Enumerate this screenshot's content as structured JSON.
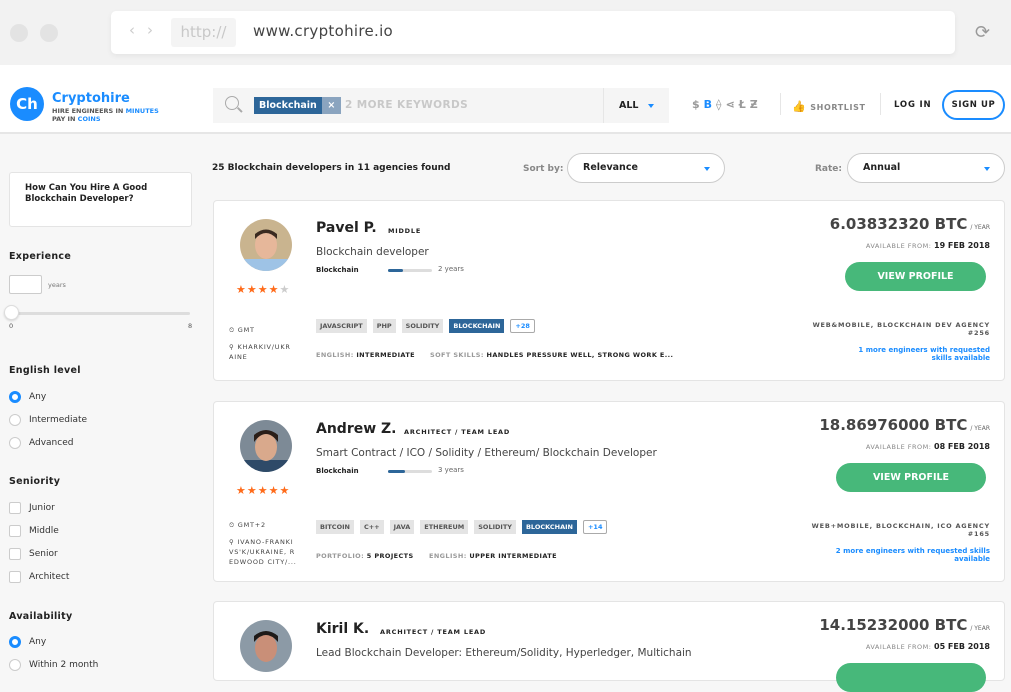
{
  "browser": {
    "protocol": "http://",
    "url": "www.cryptohire.io",
    "back_icon": "‹",
    "forward_icon": "›",
    "reload_icon": "⟳"
  },
  "header": {
    "logo": {
      "mark": "Ch",
      "name": "Cryptohire",
      "tag1a": "HIRE ENGINEERS IN ",
      "tag1b": "MINUTES",
      "tag2a": "PAY IN ",
      "tag2b": "COINS"
    },
    "search": {
      "chip": "Blockchain",
      "chip_remove": "×",
      "placeholder": "2 MORE KEYWORDS",
      "scope": "ALL"
    },
    "currencies": [
      "$",
      "B",
      "⟠",
      "⋖",
      "Ł",
      "Ƶ"
    ],
    "active_currency": "B",
    "shortlist": "SHORTLIST",
    "shortlist_icon": "👍",
    "login": "LOG IN",
    "signup": "SIGN UP"
  },
  "sidebar": {
    "guide": "How Can You Hire A Good Blockchain Developer?",
    "experience": {
      "title": "Experience",
      "value": "",
      "unit": "years",
      "min": "0",
      "max": "8",
      "slider_value": 0
    },
    "english": {
      "title": "English level",
      "options": [
        "Any",
        "Intermediate",
        "Advanced"
      ],
      "selected": "Any"
    },
    "seniority": {
      "title": "Seniority",
      "options": [
        "Junior",
        "Middle",
        "Senior",
        "Architect"
      ]
    },
    "availability": {
      "title": "Availability",
      "options": [
        "Any",
        "Within 2 month"
      ],
      "selected": "Any"
    }
  },
  "results": {
    "summary": "25 Blockchain developers in 11 agencies found",
    "sort_label": "Sort by:",
    "sort_value": "Relevance",
    "rate_label": "Rate:",
    "rate_value": "Annual"
  },
  "cards": [
    {
      "name": "Pavel P.",
      "level": "MIDDLE",
      "title": "Blockchain developer",
      "skill": "Blockchain",
      "skill_fraction": 0.33,
      "years": "2 years",
      "rating": 4.5,
      "stars": "★★★★",
      "half": "★",
      "timezone": "GMT",
      "location": "KHARKIV/UKR AINE",
      "tags": [
        "JAVASCRIPT",
        "PHP",
        "SOLIDITY"
      ],
      "tag_hl": "BLOCKCHAIN",
      "tag_more": "+28",
      "meta1_k": "ENGLISH: ",
      "meta1_v": "INTERMEDIATE",
      "meta2_k": "SOFT SKILLS: ",
      "meta2_v": "HANDLES PRESSURE WELL, STRONG WORK E...",
      "price": "6.03832320 BTC",
      "per": "/ YEAR",
      "avail_k": "AVAILABLE FROM: ",
      "avail_v": "19 FEB 2018",
      "button": "VIEW PROFILE",
      "agency": "WEB&MOBILE, BLOCKCHAIN DEV AGENCY #256",
      "more": "1 more engineers with requested skills available"
    },
    {
      "name": "Andrew Z.",
      "level": "ARCHITECT / TEAM LEAD",
      "title": "Smart Contract / ICO / Solidity / Ethereum/ Blockchain Developer",
      "skill": "Blockchain",
      "skill_fraction": 0.38,
      "years": "3 years",
      "rating": 5,
      "stars": "★★★★★",
      "half": "",
      "timezone": "GMT+2",
      "location": "IVANO-FRANKI VS'K/UKRAINE, R EDWOOD CITY/...",
      "tags": [
        "BITCOIN",
        "C++",
        "JAVA",
        "ETHEREUM",
        "SOLIDITY"
      ],
      "tag_hl": "BLOCKCHAIN",
      "tag_more": "+14",
      "meta1_k": "PORTFOLIO: ",
      "meta1_v": "5 PROJECTS",
      "meta2_k": "ENGLISH: ",
      "meta2_v": "UPPER INTERMEDIATE",
      "price": "18.86976000 BTC",
      "per": "/ YEAR",
      "avail_k": "AVAILABLE FROM: ",
      "avail_v": "08 FEB 2018",
      "button": "VIEW PROFILE",
      "agency": "WEB+MOBILE, BLOCKCHAIN, ICO AGENCY #165",
      "more": "2 more engineers with requested skills available"
    },
    {
      "name": "Kiril K.",
      "level": "ARCHITECT / TEAM LEAD",
      "title": "Lead Blockchain Developer: Ethereum/Solidity, Hyperledger, Multichain",
      "price": "14.15232000 BTC",
      "per": "/ YEAR",
      "avail_k": "AVAILABLE FROM: ",
      "avail_v": "05 FEB 2018"
    }
  ]
}
